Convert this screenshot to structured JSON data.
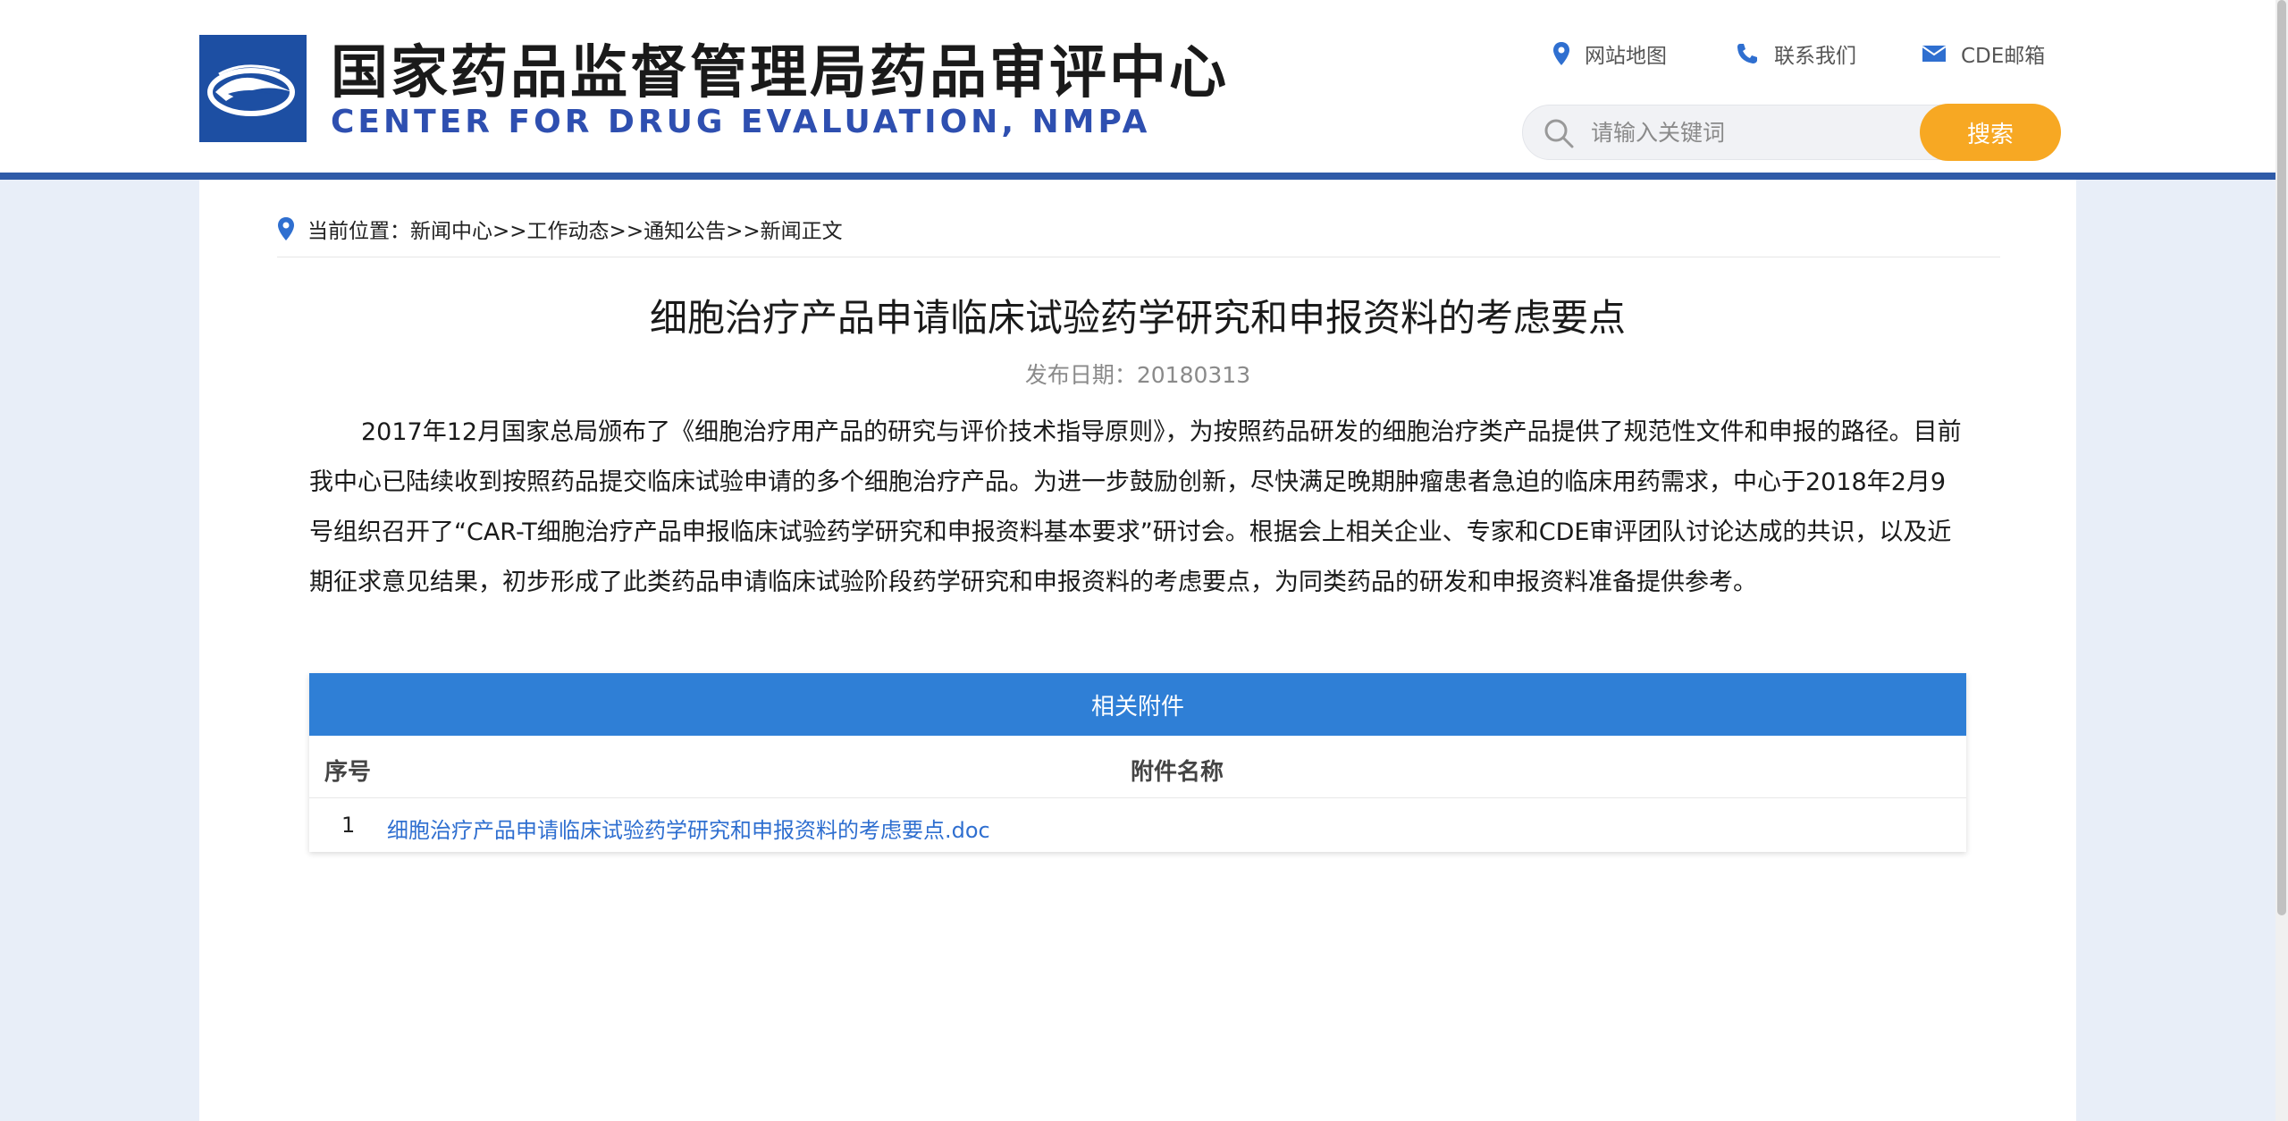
{
  "header": {
    "title_cn": "国家药品监督管理局药品审评中心",
    "title_en": "CENTER FOR DRUG EVALUATION, NMPA",
    "links": {
      "sitemap": "网站地图",
      "contact": "联系我们",
      "mail": "CDE邮箱"
    },
    "search": {
      "placeholder": "请输入关键词",
      "button_label": "搜索"
    }
  },
  "breadcrumb": {
    "prefix": "当前位置：",
    "path": "新闻中心>>工作动态>>通知公告>>新闻正文"
  },
  "article": {
    "title": "细胞治疗产品申请临床试验药学研究和申报资料的考虑要点",
    "date": "发布日期：20180313",
    "body": "2017年12月国家总局颁布了《细胞治疗用产品的研究与评价技术指导原则》，为按照药品研发的细胞治疗类产品提供了规范性文件和申报的路径。目前我中心已陆续收到按照药品提交临床试验申请的多个细胞治疗产品。为进一步鼓励创新，尽快满足晚期肿瘤患者急迫的临床用药需求，中心于2018年2月9号组织召开了“CAR-T细胞治疗产品申报临床试验药学研究和申报资料基本要求”研讨会。根据会上相关企业、专家和CDE审评团队讨论达成的共识，以及近期征求意见结果，初步形成了此类药品申请临床试验阶段药学研究和申报资料的考虑要点，为同类药品的研发和申报资料准备提供参考。"
  },
  "attachments": {
    "header": "相关附件",
    "col_index": "序号",
    "col_name": "附件名称",
    "rows": [
      {
        "index": "1",
        "name": "细胞治疗产品申请临床试验药学研究和申报资料的考虑要点.doc"
      }
    ]
  },
  "colors": {
    "brand_blue": "#2f5ba8",
    "accent_orange": "#f7a823",
    "attach_header": "#2f7fd6",
    "link": "#2f6fd0"
  }
}
